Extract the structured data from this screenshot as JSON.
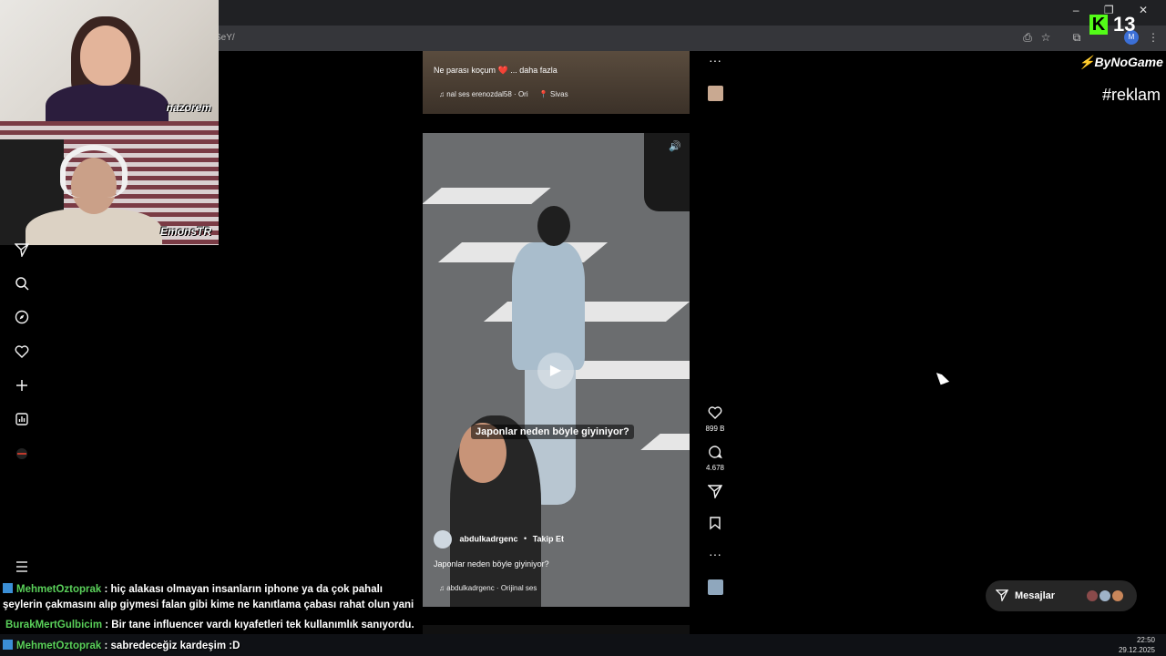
{
  "browser": {
    "url_fragment": "SeY/",
    "window_controls": "– ❐ ✕"
  },
  "streamers": {
    "cam1_name": "nazorem",
    "cam2_name": "EmonsTR"
  },
  "nav": {
    "icons": [
      "send-icon",
      "search-icon",
      "explore-icon",
      "heart-icon",
      "create-icon",
      "dashboard-icon",
      "profile-icon",
      "menu-icon"
    ]
  },
  "post1": {
    "caption": "Ne parası koçum ❤️ ... daha fazla",
    "audio": "♫ nal ses  erenozdal58 · Ori",
    "location": "📍 Sivas"
  },
  "post2": {
    "overlay_title": "Japonlar neden böyle giyiniyor?",
    "username": "abdulkadrgenc",
    "follow_label": "Takip Et",
    "caption": "Japonlar neden böyle giyiniyor?",
    "audio": "♫ abdulkadrgenc · Orijinal ses"
  },
  "actions": {
    "likes": "899 B",
    "comments": "4.678"
  },
  "overlay": {
    "kick_logo": "K",
    "viewer_count": "13",
    "brand": "ByNoGame",
    "hashtag": "#reklam"
  },
  "messages": {
    "label": "Mesajlar"
  },
  "chat": [
    {
      "user": "MehmetOztoprak",
      "text": ": hiç alakası olmayan insanların iphone ya da çok pahalı"
    },
    {
      "user": "",
      "text": "şeylerin çakmasını alıp giymesi falan gibi kime ne kanıtlama çabası rahat olun yani"
    },
    {
      "user": "BurakMertGulbicim",
      "text": ": Bir tane influencer vardı kıyafetleri tek kullanımlık sanıyordu."
    },
    {
      "user": "MehmetOztoprak",
      "text": ": sabredeceğiz kardeşim :D"
    }
  ],
  "taskbar": {
    "time": "22:50",
    "date": "29.12.2025"
  },
  "colors": {
    "background": "#000000",
    "kick_green": "#53fc18",
    "chat_user_green": "#5ad15a",
    "brand_red": "#e03b3b"
  }
}
